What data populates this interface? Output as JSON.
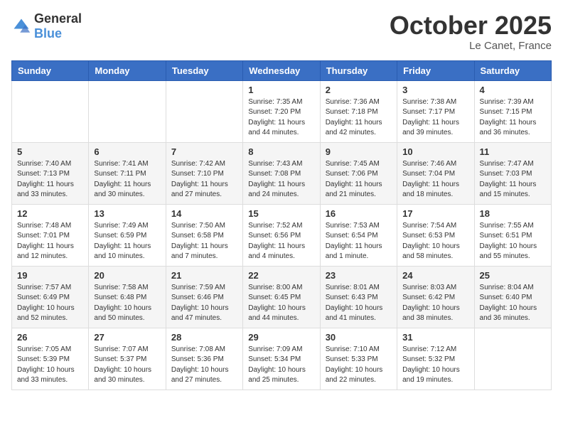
{
  "logo": {
    "general": "General",
    "blue": "Blue"
  },
  "header": {
    "month": "October 2025",
    "location": "Le Canet, France"
  },
  "weekdays": [
    "Sunday",
    "Monday",
    "Tuesday",
    "Wednesday",
    "Thursday",
    "Friday",
    "Saturday"
  ],
  "weeks": [
    [
      {
        "day": "",
        "info": ""
      },
      {
        "day": "",
        "info": ""
      },
      {
        "day": "",
        "info": ""
      },
      {
        "day": "1",
        "info": "Sunrise: 7:35 AM\nSunset: 7:20 PM\nDaylight: 11 hours\nand 44 minutes."
      },
      {
        "day": "2",
        "info": "Sunrise: 7:36 AM\nSunset: 7:18 PM\nDaylight: 11 hours\nand 42 minutes."
      },
      {
        "day": "3",
        "info": "Sunrise: 7:38 AM\nSunset: 7:17 PM\nDaylight: 11 hours\nand 39 minutes."
      },
      {
        "day": "4",
        "info": "Sunrise: 7:39 AM\nSunset: 7:15 PM\nDaylight: 11 hours\nand 36 minutes."
      }
    ],
    [
      {
        "day": "5",
        "info": "Sunrise: 7:40 AM\nSunset: 7:13 PM\nDaylight: 11 hours\nand 33 minutes."
      },
      {
        "day": "6",
        "info": "Sunrise: 7:41 AM\nSunset: 7:11 PM\nDaylight: 11 hours\nand 30 minutes."
      },
      {
        "day": "7",
        "info": "Sunrise: 7:42 AM\nSunset: 7:10 PM\nDaylight: 11 hours\nand 27 minutes."
      },
      {
        "day": "8",
        "info": "Sunrise: 7:43 AM\nSunset: 7:08 PM\nDaylight: 11 hours\nand 24 minutes."
      },
      {
        "day": "9",
        "info": "Sunrise: 7:45 AM\nSunset: 7:06 PM\nDaylight: 11 hours\nand 21 minutes."
      },
      {
        "day": "10",
        "info": "Sunrise: 7:46 AM\nSunset: 7:04 PM\nDaylight: 11 hours\nand 18 minutes."
      },
      {
        "day": "11",
        "info": "Sunrise: 7:47 AM\nSunset: 7:03 PM\nDaylight: 11 hours\nand 15 minutes."
      }
    ],
    [
      {
        "day": "12",
        "info": "Sunrise: 7:48 AM\nSunset: 7:01 PM\nDaylight: 11 hours\nand 12 minutes."
      },
      {
        "day": "13",
        "info": "Sunrise: 7:49 AM\nSunset: 6:59 PM\nDaylight: 11 hours\nand 10 minutes."
      },
      {
        "day": "14",
        "info": "Sunrise: 7:50 AM\nSunset: 6:58 PM\nDaylight: 11 hours\nand 7 minutes."
      },
      {
        "day": "15",
        "info": "Sunrise: 7:52 AM\nSunset: 6:56 PM\nDaylight: 11 hours\nand 4 minutes."
      },
      {
        "day": "16",
        "info": "Sunrise: 7:53 AM\nSunset: 6:54 PM\nDaylight: 11 hours\nand 1 minute."
      },
      {
        "day": "17",
        "info": "Sunrise: 7:54 AM\nSunset: 6:53 PM\nDaylight: 10 hours\nand 58 minutes."
      },
      {
        "day": "18",
        "info": "Sunrise: 7:55 AM\nSunset: 6:51 PM\nDaylight: 10 hours\nand 55 minutes."
      }
    ],
    [
      {
        "day": "19",
        "info": "Sunrise: 7:57 AM\nSunset: 6:49 PM\nDaylight: 10 hours\nand 52 minutes."
      },
      {
        "day": "20",
        "info": "Sunrise: 7:58 AM\nSunset: 6:48 PM\nDaylight: 10 hours\nand 50 minutes."
      },
      {
        "day": "21",
        "info": "Sunrise: 7:59 AM\nSunset: 6:46 PM\nDaylight: 10 hours\nand 47 minutes."
      },
      {
        "day": "22",
        "info": "Sunrise: 8:00 AM\nSunset: 6:45 PM\nDaylight: 10 hours\nand 44 minutes."
      },
      {
        "day": "23",
        "info": "Sunrise: 8:01 AM\nSunset: 6:43 PM\nDaylight: 10 hours\nand 41 minutes."
      },
      {
        "day": "24",
        "info": "Sunrise: 8:03 AM\nSunset: 6:42 PM\nDaylight: 10 hours\nand 38 minutes."
      },
      {
        "day": "25",
        "info": "Sunrise: 8:04 AM\nSunset: 6:40 PM\nDaylight: 10 hours\nand 36 minutes."
      }
    ],
    [
      {
        "day": "26",
        "info": "Sunrise: 7:05 AM\nSunset: 5:39 PM\nDaylight: 10 hours\nand 33 minutes."
      },
      {
        "day": "27",
        "info": "Sunrise: 7:07 AM\nSunset: 5:37 PM\nDaylight: 10 hours\nand 30 minutes."
      },
      {
        "day": "28",
        "info": "Sunrise: 7:08 AM\nSunset: 5:36 PM\nDaylight: 10 hours\nand 27 minutes."
      },
      {
        "day": "29",
        "info": "Sunrise: 7:09 AM\nSunset: 5:34 PM\nDaylight: 10 hours\nand 25 minutes."
      },
      {
        "day": "30",
        "info": "Sunrise: 7:10 AM\nSunset: 5:33 PM\nDaylight: 10 hours\nand 22 minutes."
      },
      {
        "day": "31",
        "info": "Sunrise: 7:12 AM\nSunset: 5:32 PM\nDaylight: 10 hours\nand 19 minutes."
      },
      {
        "day": "",
        "info": ""
      }
    ]
  ]
}
